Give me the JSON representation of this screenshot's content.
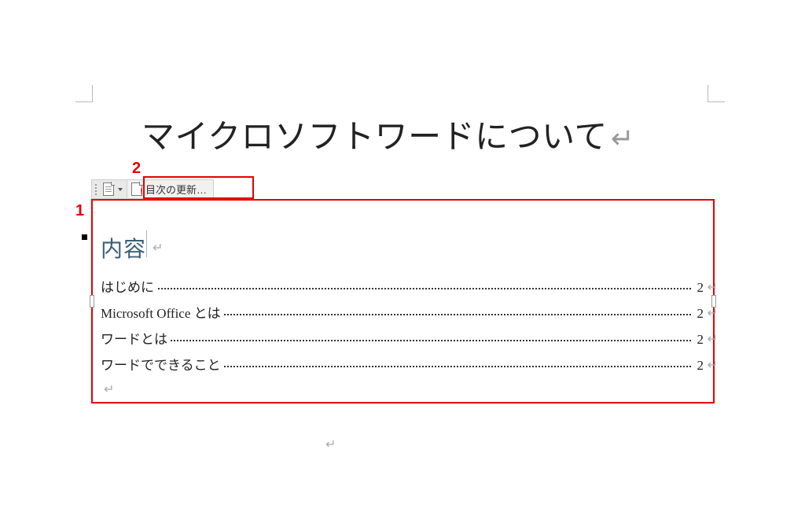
{
  "annotations": {
    "label1": "1",
    "label2": "2"
  },
  "doc": {
    "title": "マイクロソフトワードについて"
  },
  "toolbar": {
    "update_label": "目次の更新…"
  },
  "toc": {
    "heading": "内容",
    "entries": [
      {
        "title": "はじめに",
        "page": "2"
      },
      {
        "title": "Microsoft Office とは",
        "page": "2"
      },
      {
        "title": "ワードとは",
        "page": "2"
      },
      {
        "title": "ワードでできること",
        "page": "2"
      }
    ]
  },
  "glyphs": {
    "enter": "↵"
  }
}
